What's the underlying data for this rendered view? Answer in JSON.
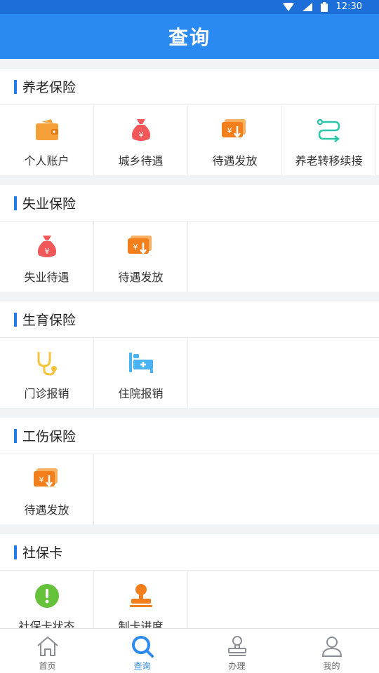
{
  "status_bar": {
    "time": "12:30"
  },
  "header": {
    "title": "查询"
  },
  "colors": {
    "accent": "#2b89f2",
    "status_bar": "#1c6fd8",
    "section_bar": "#1f7ce8"
  },
  "sections": [
    {
      "title": "养老保险",
      "items": [
        {
          "label": "个人账户",
          "icon": "wallet-icon"
        },
        {
          "label": "城乡待遇",
          "icon": "money-bag-icon"
        },
        {
          "label": "待遇发放",
          "icon": "payout-icon"
        },
        {
          "label": "养老转移续接",
          "icon": "transfer-icon"
        }
      ]
    },
    {
      "title": "失业保险",
      "items": [
        {
          "label": "失业待遇",
          "icon": "money-bag-icon"
        },
        {
          "label": "待遇发放",
          "icon": "payout-icon"
        }
      ]
    },
    {
      "title": "生育保险",
      "items": [
        {
          "label": "门诊报销",
          "icon": "stethoscope-icon"
        },
        {
          "label": "住院报销",
          "icon": "hospital-bed-icon"
        }
      ]
    },
    {
      "title": "工伤保险",
      "items": [
        {
          "label": "待遇发放",
          "icon": "payout-icon"
        }
      ]
    },
    {
      "title": "社保卡",
      "items": [
        {
          "label": "社保卡状态",
          "icon": "alert-icon"
        },
        {
          "label": "制卡进度",
          "icon": "stamp-icon"
        }
      ]
    }
  ],
  "tabs": [
    {
      "label": "首页",
      "icon": "home-icon"
    },
    {
      "label": "查询",
      "icon": "search-icon"
    },
    {
      "label": "办理",
      "icon": "handle-icon"
    },
    {
      "label": "我的",
      "icon": "user-icon"
    }
  ]
}
